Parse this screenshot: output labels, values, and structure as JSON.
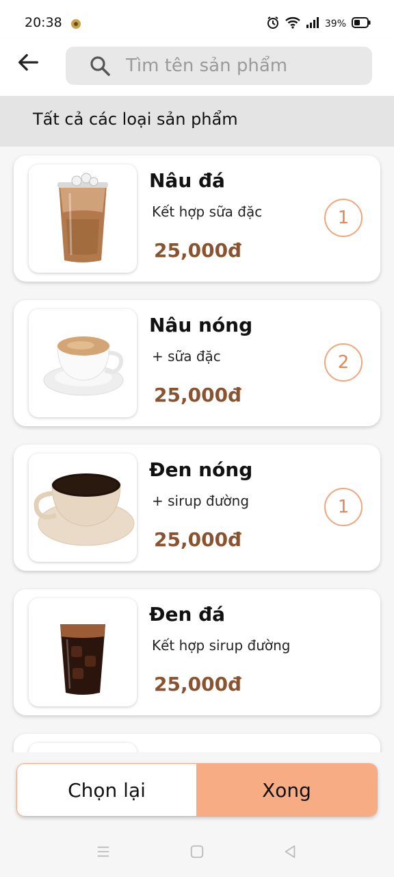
{
  "status": {
    "time": "20:38",
    "battery": "39%"
  },
  "search": {
    "placeholder": "Tìm tên sản phẩm"
  },
  "category": {
    "label": "Tất cả các loại sản phẩm"
  },
  "products": [
    {
      "name": "Nâu đá",
      "desc": "Kết hợp sữa đặc",
      "price": "25,000đ",
      "qty": "1",
      "image": "iced-milk-coffee"
    },
    {
      "name": "Nâu nóng",
      "desc": "+ sữa đặc",
      "price": "25,000đ",
      "qty": "2",
      "image": "hot-milk-coffee"
    },
    {
      "name": "Đen nóng",
      "desc": "+ sirup đường",
      "price": "25,000đ",
      "qty": "1",
      "image": "hot-black-coffee"
    },
    {
      "name": "Đen đá",
      "desc": "Kết hợp sirup đường",
      "price": "25,000đ",
      "qty": "",
      "image": "iced-black-coffee"
    }
  ],
  "footer": {
    "reset_label": "Chọn lại",
    "done_label": "Xong"
  },
  "colors": {
    "accent": "#f7ac84",
    "price": "#8a5330",
    "badge": "#e0875a"
  }
}
